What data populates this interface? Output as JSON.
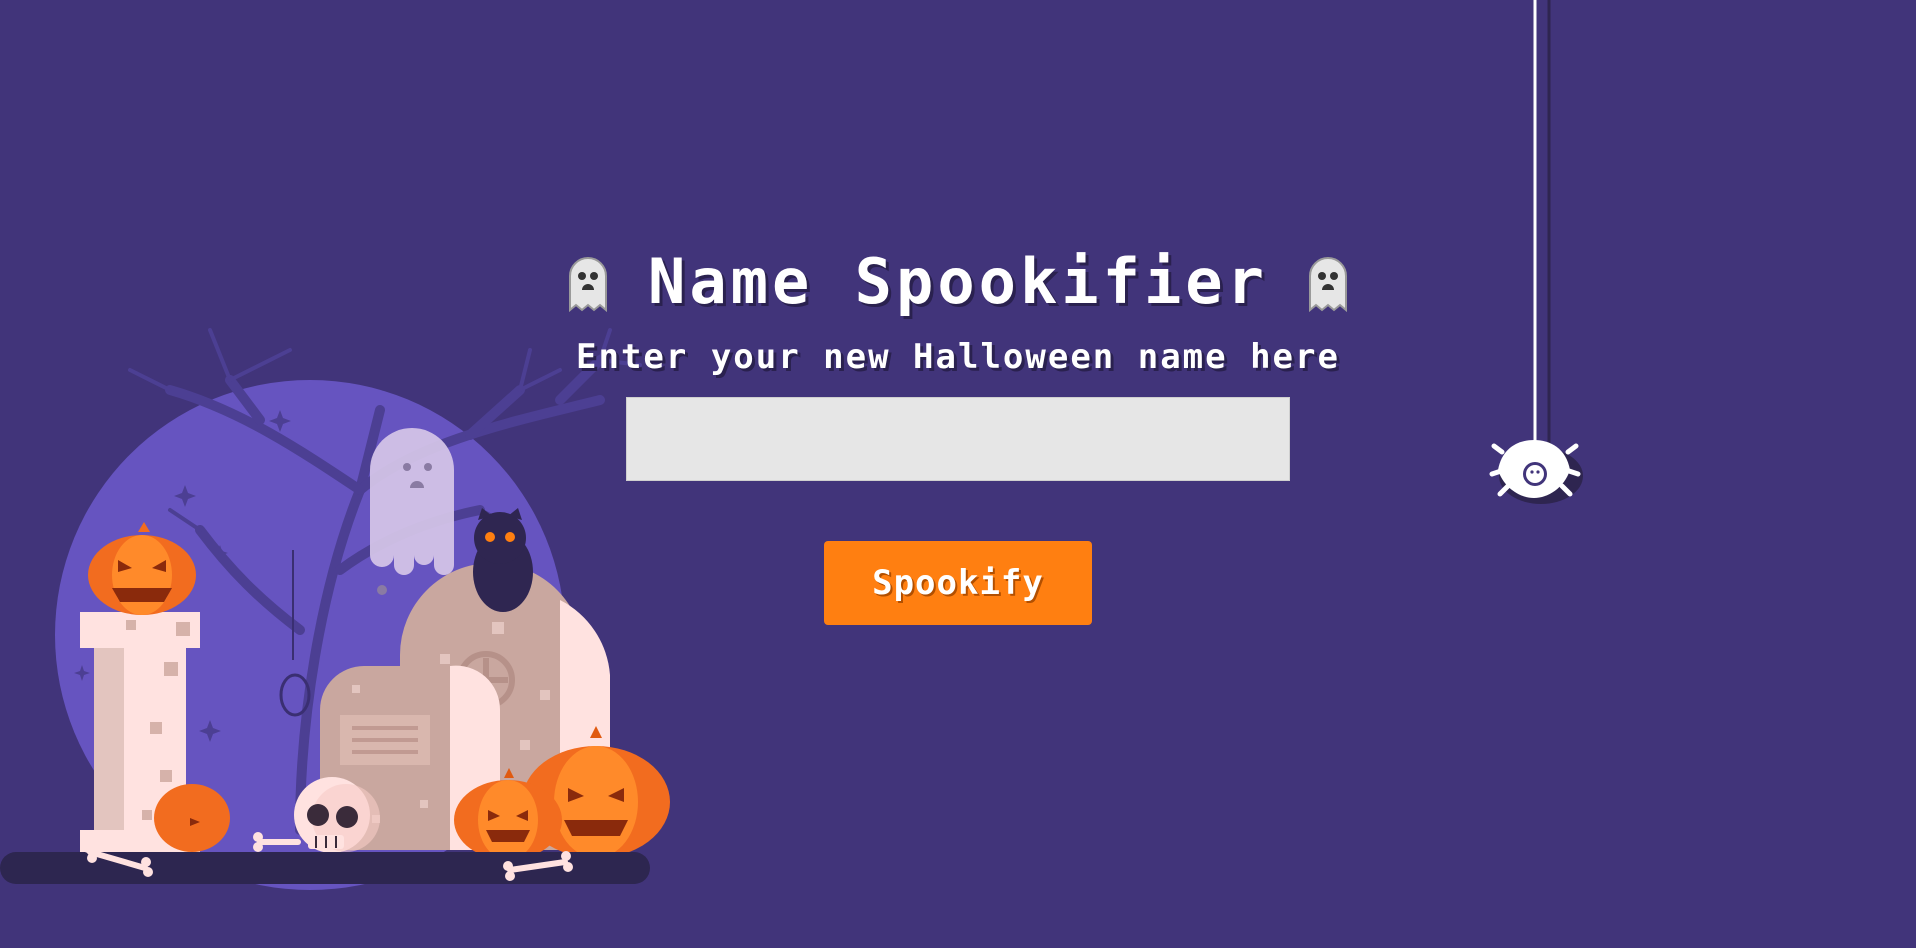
{
  "header": {
    "title": "Name Spookifier",
    "subtitle": "Enter your new Halloween name here",
    "left_icon": "ghost-icon",
    "right_icon": "ghost-icon"
  },
  "form": {
    "name_input_value": "",
    "name_input_placeholder": "",
    "submit_label": "Spookify"
  },
  "decorations": {
    "scene": "graveyard-illustration",
    "hanging": "spider-icon"
  },
  "colors": {
    "background": "#41347a",
    "moon": "#6654c0",
    "accent": "#ff7f11",
    "input_bg": "#e6e6e6",
    "text": "#ffffff"
  }
}
